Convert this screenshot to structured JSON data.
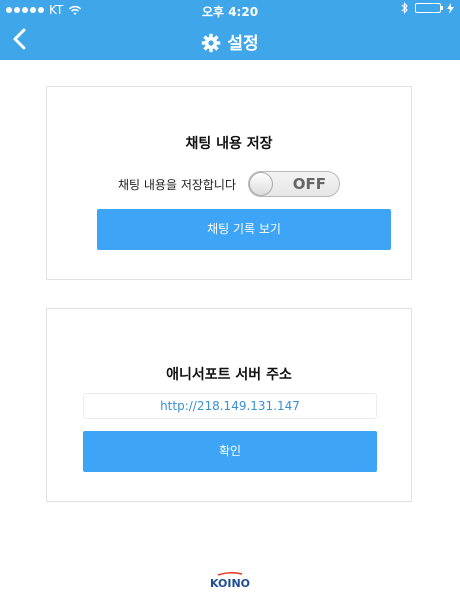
{
  "status_bar": {
    "carrier": "KT",
    "time": "오후 4:20",
    "battery_level": 1.0,
    "battery_color": "#5ce06a"
  },
  "nav": {
    "title": "설정",
    "back_icon": "chevron-left-icon",
    "title_icon": "gear-icon",
    "bg_color": "#40a6ea"
  },
  "chat_save": {
    "title": "채팅 내용 저장",
    "toggle_label": "채팅 내용을 저장합니다",
    "toggle_state": "OFF",
    "history_button": "채팅 기록 보기"
  },
  "server": {
    "title": "애니서포트 서버 주소",
    "address": "http://218.149.131.147",
    "confirm_button": "확인"
  },
  "footer": {
    "logo_text": "KOINO"
  },
  "colors": {
    "button": "#3ea4f5",
    "link_text": "#3a8fd8"
  }
}
